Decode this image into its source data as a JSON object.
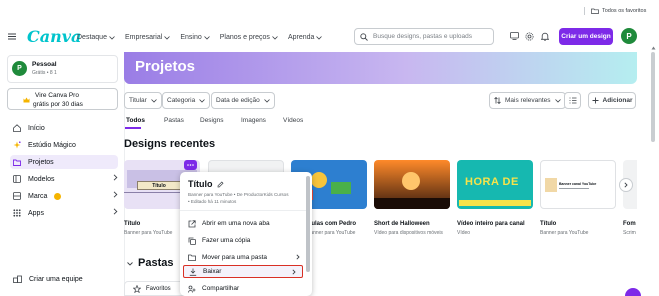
{
  "top_right_link": "Todos os favoritos",
  "header": {
    "logo": "Canva",
    "nav": [
      "Destaque",
      "Empresarial",
      "Ensino",
      "Planos e preços",
      "Aprenda"
    ],
    "search_placeholder": "Busque designs, pastas e uploads",
    "create_button": "Criar um design",
    "avatar_letter": "P"
  },
  "sidebar": {
    "account_name": "Pessoal",
    "account_plan": "Grátis • 8 1",
    "avatar_letter": "P",
    "promo_line1": "Vire Canva Pro",
    "promo_line2": "grátis por 30 dias",
    "items": [
      {
        "label": "Início",
        "icon": "home-icon"
      },
      {
        "label": "Estúdio Mágico",
        "icon": "magic-studio-icon"
      },
      {
        "label": "Projetos",
        "icon": "folder-icon"
      },
      {
        "label": "Modelos",
        "icon": "templates-icon"
      },
      {
        "label": "Marca",
        "icon": "brand-icon"
      },
      {
        "label": "Apps",
        "icon": "apps-icon"
      }
    ],
    "create_team": "Criar uma equipe"
  },
  "main": {
    "banner_title": "Projetos",
    "filters": [
      "Titular",
      "Categoria",
      "Data de edição"
    ],
    "sort_label": "Mais relevantes",
    "add_button": "Adicionar",
    "tabs": [
      "Todos",
      "Pastas",
      "Designs",
      "Imagens",
      "Vídeos"
    ],
    "designs_heading": "Designs recentes",
    "pastas_heading": "Pastas",
    "favoritos": "Favoritos"
  },
  "designs": [
    {
      "title": "Título",
      "subtitle": "Banner para YouTube",
      "thumb_text": "Título"
    },
    {
      "title": "Aulas com Pedro",
      "subtitle": "Banner para YouTube",
      "thumb_text": ""
    },
    {
      "title": "Short de Halloween",
      "subtitle": "Vídeo para dispositivos móveis",
      "thumb_text": ""
    },
    {
      "title": "Vídeo inteiro para canal",
      "subtitle": "Vídeo",
      "thumb_text": "HORA DE"
    },
    {
      "title": "Título",
      "subtitle": "Banner para YouTube",
      "thumb_text": "Banner canal YouTube"
    },
    {
      "title": "Fom",
      "subtitle": "Scrim",
      "thumb_text": ""
    }
  ],
  "context_menu": {
    "title": "Título",
    "detail1": "Banner para YouTube • De ProductorKids Cursos",
    "detail2": "• Editado há 11 minutos",
    "items": [
      {
        "label": "Abrir em uma nova aba",
        "icon": "external-link-icon"
      },
      {
        "label": "Fazer uma cópia",
        "icon": "copy-icon"
      },
      {
        "label": "Mover para uma pasta",
        "icon": "folder-move-icon"
      },
      {
        "label": "Baixar",
        "icon": "download-icon"
      },
      {
        "label": "Compartilhar",
        "icon": "share-icon"
      }
    ]
  },
  "colors": {
    "accent": "#7d2ae8",
    "banner_gradient_start": "#9a7de6",
    "banner_gradient_end": "#b5eef0",
    "highlight_red": "#d93025",
    "active_sidebar_bg": "#efeafb"
  }
}
